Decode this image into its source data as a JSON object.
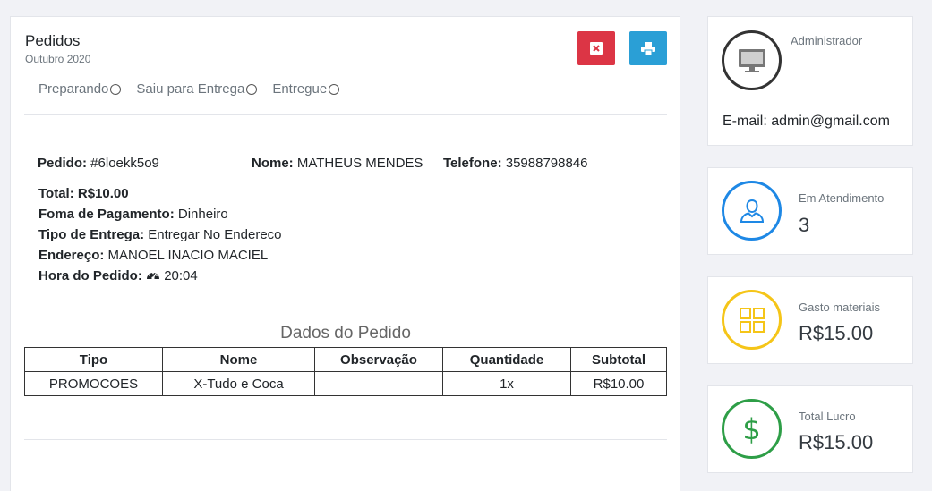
{
  "order_panel": {
    "title": "Pedidos",
    "subtitle": "Outubro 2020",
    "status_options": [
      "Preparando",
      "Saiu para Entrega",
      "Entregue"
    ],
    "pedido_label": "Pedido:",
    "pedido_value": "#6loekk5o9",
    "nome_label": "Nome:",
    "nome_value": "MATHEUS MENDES",
    "telefone_label": "Telefone:",
    "telefone_value": "35988798846",
    "total_label": "Total:",
    "total_value": "R$10.00",
    "pagamento_label": "Foma de Pagamento:",
    "pagamento_value": "Dinheiro",
    "entrega_label": "Tipo de Entrega:",
    "entrega_value": "Entregar No Endereco",
    "endereco_label": "Endereço:",
    "endereco_value": "MANOEL INACIO MACIEL",
    "hora_label": "Hora do Pedido:",
    "hora_value": "20:04",
    "section_title": "Dados do Pedido",
    "table": {
      "headers": [
        "Tipo",
        "Nome",
        "Observação",
        "Quantidade",
        "Subtotal"
      ],
      "rows": [
        [
          "PROMOCOES",
          "X-Tudo e Coca",
          "",
          "1x",
          "R$10.00"
        ]
      ]
    }
  },
  "sidebar": {
    "admin": {
      "label": "Administrador",
      "email": "E-mail: admin@gmail.com",
      "icon": "monitor-icon"
    },
    "stats": [
      {
        "label": "Em Atendimento",
        "value": "3",
        "icon": "user-icon",
        "color": "#1e88e5"
      },
      {
        "label": "Gasto materiais",
        "value": "R$15.00",
        "icon": "grid-icon",
        "color": "#f5c518"
      },
      {
        "label": "Total Lucro",
        "value": "R$15.00",
        "icon": "dollar-icon",
        "color": "#2e9e47"
      }
    ]
  },
  "colors": {
    "delete_button": "#dc3545",
    "print_button": "#2a9fd6"
  }
}
